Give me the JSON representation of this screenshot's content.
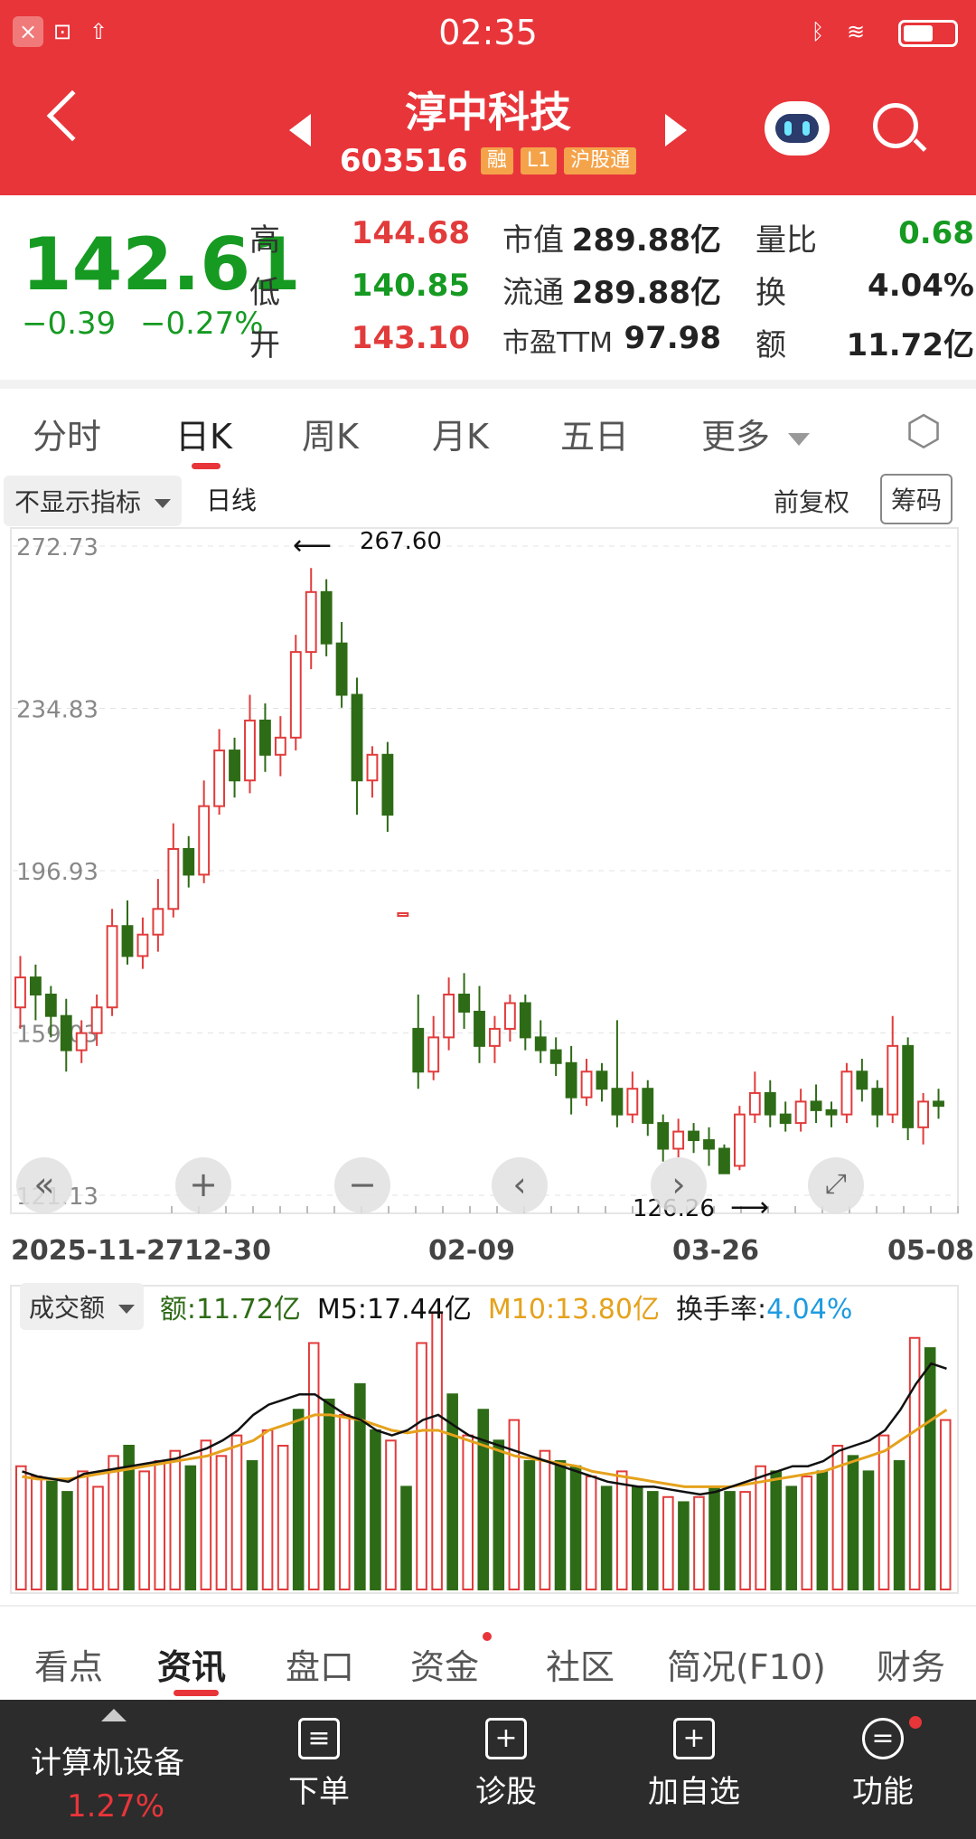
{
  "status_bar": {
    "time": "02:35"
  },
  "header": {
    "title": "淳中科技",
    "code": "603516",
    "tags": [
      "融",
      "L1",
      "沪股通"
    ]
  },
  "quote": {
    "price": "142.61",
    "change": "−0.39",
    "change_pct": "−0.27%",
    "rows": [
      {
        "l1": "高",
        "v1": "144.68",
        "l2": "市值",
        "v2": "289.88亿",
        "l3": "量比",
        "v3": "0.68"
      },
      {
        "l1": "低",
        "v1": "140.85",
        "l2": "流通",
        "v2": "289.88亿",
        "l3": "换",
        "v3": "4.04%"
      },
      {
        "l1": "开",
        "v1": "143.10",
        "l2": "市盈TTM",
        "v2": "97.98",
        "l3": "额",
        "v3": "11.72亿"
      }
    ]
  },
  "tabs": [
    "分时",
    "日K",
    "周K",
    "月K",
    "五日",
    "更多"
  ],
  "toolbar": {
    "indicator": "不显示指标",
    "period": "日线",
    "adjust": "前复权",
    "chips": "筹码"
  },
  "chart_data": {
    "type": "candlestick",
    "ylabels": [
      "272.73",
      "234.83",
      "196.93",
      "159.03",
      "121.13"
    ],
    "ylim": [
      121.13,
      272.73
    ],
    "dates": [
      "2025-11-27",
      "12-30",
      "02-09",
      "03-26",
      "05-08"
    ],
    "annotations": {
      "high": "267.60",
      "low": "126.26"
    },
    "candles": [
      {
        "o": 165,
        "c": 172,
        "h": 177,
        "l": 160
      },
      {
        "o": 172,
        "c": 168,
        "h": 175,
        "l": 162
      },
      {
        "o": 168,
        "c": 163,
        "h": 170,
        "l": 158
      },
      {
        "o": 163,
        "c": 155,
        "h": 167,
        "l": 150
      },
      {
        "o": 155,
        "c": 159,
        "h": 162,
        "l": 152
      },
      {
        "o": 159,
        "c": 165,
        "h": 168,
        "l": 156
      },
      {
        "o": 165,
        "c": 184,
        "h": 188,
        "l": 163
      },
      {
        "o": 184,
        "c": 177,
        "h": 190,
        "l": 175
      },
      {
        "o": 177,
        "c": 182,
        "h": 186,
        "l": 174
      },
      {
        "o": 182,
        "c": 188,
        "h": 195,
        "l": 178
      },
      {
        "o": 188,
        "c": 202,
        "h": 208,
        "l": 186
      },
      {
        "o": 202,
        "c": 196,
        "h": 205,
        "l": 193
      },
      {
        "o": 196,
        "c": 212,
        "h": 218,
        "l": 194
      },
      {
        "o": 212,
        "c": 225,
        "h": 230,
        "l": 210
      },
      {
        "o": 225,
        "c": 218,
        "h": 228,
        "l": 214
      },
      {
        "o": 218,
        "c": 232,
        "h": 238,
        "l": 215
      },
      {
        "o": 232,
        "c": 224,
        "h": 236,
        "l": 220
      },
      {
        "o": 224,
        "c": 228,
        "h": 233,
        "l": 219
      },
      {
        "o": 228,
        "c": 248,
        "h": 252,
        "l": 225
      },
      {
        "o": 248,
        "c": 262,
        "h": 267.6,
        "l": 244
      },
      {
        "o": 262,
        "c": 250,
        "h": 265,
        "l": 247
      },
      {
        "o": 250,
        "c": 238,
        "h": 255,
        "l": 235
      },
      {
        "o": 238,
        "c": 218,
        "h": 242,
        "l": 210
      },
      {
        "o": 218,
        "c": 224,
        "h": 226,
        "l": 214
      },
      {
        "o": 224,
        "c": 210,
        "h": 227,
        "l": 206
      },
      {
        "o": 187,
        "c": 187,
        "h": 187,
        "l": 187
      },
      {
        "o": 160,
        "c": 150,
        "h": 168,
        "l": 146
      },
      {
        "o": 150,
        "c": 158,
        "h": 163,
        "l": 148
      },
      {
        "o": 158,
        "c": 168,
        "h": 172,
        "l": 155
      },
      {
        "o": 168,
        "c": 164,
        "h": 173,
        "l": 160
      },
      {
        "o": 164,
        "c": 156,
        "h": 170,
        "l": 152
      },
      {
        "o": 156,
        "c": 160,
        "h": 163,
        "l": 152
      },
      {
        "o": 160,
        "c": 166,
        "h": 168,
        "l": 157
      },
      {
        "o": 166,
        "c": 158,
        "h": 168,
        "l": 155
      },
      {
        "o": 158,
        "c": 155,
        "h": 162,
        "l": 152
      },
      {
        "o": 155,
        "c": 152,
        "h": 158,
        "l": 149
      },
      {
        "o": 152,
        "c": 144,
        "h": 156,
        "l": 140
      },
      {
        "o": 144,
        "c": 150,
        "h": 153,
        "l": 142
      },
      {
        "o": 150,
        "c": 146,
        "h": 152,
        "l": 143
      },
      {
        "o": 146,
        "c": 140,
        "h": 162,
        "l": 137
      },
      {
        "o": 140,
        "c": 146,
        "h": 150,
        "l": 138
      },
      {
        "o": 146,
        "c": 138,
        "h": 148,
        "l": 135
      },
      {
        "o": 138,
        "c": 132,
        "h": 140,
        "l": 129
      },
      {
        "o": 132,
        "c": 136,
        "h": 139,
        "l": 130
      },
      {
        "o": 136,
        "c": 134,
        "h": 138,
        "l": 131
      },
      {
        "o": 134,
        "c": 132,
        "h": 137,
        "l": 128
      },
      {
        "o": 132,
        "c": 126.26,
        "h": 133,
        "l": 126.26
      },
      {
        "o": 128,
        "c": 140,
        "h": 142,
        "l": 127
      },
      {
        "o": 140,
        "c": 145,
        "h": 150,
        "l": 138
      },
      {
        "o": 145,
        "c": 140,
        "h": 148,
        "l": 137
      },
      {
        "o": 140,
        "c": 138,
        "h": 143,
        "l": 136
      },
      {
        "o": 138,
        "c": 143,
        "h": 146,
        "l": 136
      },
      {
        "o": 143,
        "c": 141,
        "h": 147,
        "l": 138
      },
      {
        "o": 141,
        "c": 140,
        "h": 143,
        "l": 137
      },
      {
        "o": 140,
        "c": 150,
        "h": 152,
        "l": 138
      },
      {
        "o": 150,
        "c": 146,
        "h": 153,
        "l": 143
      },
      {
        "o": 146,
        "c": 140,
        "h": 148,
        "l": 137
      },
      {
        "o": 140,
        "c": 156,
        "h": 163,
        "l": 138
      },
      {
        "o": 156,
        "c": 137,
        "h": 158,
        "l": 134
      },
      {
        "o": 137,
        "c": 143,
        "h": 145,
        "l": 133
      },
      {
        "o": 143,
        "c": 142,
        "h": 146,
        "l": 139
      }
    ]
  },
  "volume": {
    "label": "成交额",
    "amount": "额:11.72亿",
    "m5": "M5:17.44亿",
    "m10": "M10:13.80亿",
    "turnover_label": "换手率:",
    "turnover_value": "4.04%",
    "values": [
      48,
      44,
      42,
      38,
      46,
      40,
      52,
      56,
      46,
      50,
      54,
      48,
      58,
      52,
      60,
      50,
      62,
      56,
      70,
      96,
      74,
      68,
      80,
      62,
      58,
      40,
      96,
      108,
      76,
      60,
      70,
      58,
      66,
      50,
      54,
      50,
      48,
      44,
      40,
      46,
      40,
      38,
      36,
      34,
      36,
      40,
      38,
      38,
      48,
      46,
      40,
      44,
      46,
      56,
      52,
      46,
      60,
      50,
      98,
      94,
      66
    ],
    "up": [
      1,
      1,
      0,
      0,
      1,
      1,
      1,
      0,
      1,
      1,
      1,
      0,
      1,
      1,
      1,
      0,
      1,
      1,
      0,
      1,
      0,
      1,
      0,
      0,
      1,
      0,
      1,
      1,
      0,
      1,
      0,
      0,
      1,
      0,
      1,
      0,
      0,
      1,
      0,
      1,
      0,
      0,
      1,
      0,
      1,
      0,
      0,
      1,
      1,
      0,
      0,
      1,
      0,
      1,
      0,
      0,
      1,
      0,
      1,
      0,
      1
    ],
    "m5_line": [
      46,
      44,
      43,
      42,
      45,
      46,
      47,
      48,
      49,
      50,
      51,
      53,
      55,
      58,
      62,
      68,
      72,
      74,
      76,
      76,
      72,
      68,
      66,
      62,
      60,
      62,
      66,
      68,
      64,
      60,
      58,
      56,
      54,
      52,
      50,
      48,
      46,
      44,
      42,
      41,
      40,
      40,
      39,
      38,
      37,
      38,
      40,
      42,
      44,
      46,
      48,
      48,
      50,
      54,
      56,
      58,
      62,
      70,
      80,
      88,
      86
    ],
    "m10_line": [
      44,
      43,
      43,
      43,
      44,
      45,
      46,
      47,
      48,
      49,
      50,
      51,
      52,
      54,
      56,
      58,
      62,
      64,
      66,
      68,
      68,
      67,
      66,
      64,
      62,
      61,
      62,
      62,
      60,
      58,
      56,
      54,
      52,
      51,
      50,
      49,
      48,
      46,
      45,
      44,
      43,
      42,
      41,
      40,
      40,
      40,
      40,
      41,
      42,
      43,
      44,
      45,
      46,
      48,
      50,
      52,
      54,
      58,
      62,
      66,
      70
    ]
  },
  "bottom_tabs": [
    "看点",
    "资讯",
    "盘口",
    "资金",
    "社区",
    "简况(F10)",
    "财务"
  ],
  "nav": {
    "sector": "计算机设备",
    "sector_change": "1.27%",
    "items": [
      "下单",
      "诊股",
      "加自选",
      "功能"
    ]
  },
  "colors": {
    "header": "#e8353a",
    "up": "#e23b3b",
    "down": "#2e6b16",
    "m5": "#111111",
    "m10": "#e5a21c",
    "turnover": "#1e9be0"
  }
}
